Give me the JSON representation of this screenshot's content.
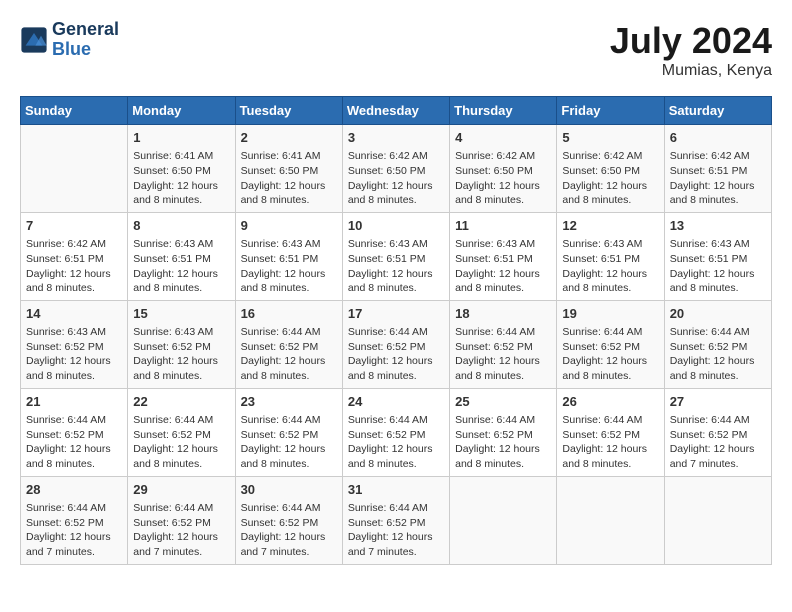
{
  "header": {
    "logo_line1": "General",
    "logo_line2": "Blue",
    "month_year": "July 2024",
    "location": "Mumias, Kenya"
  },
  "weekdays": [
    "Sunday",
    "Monday",
    "Tuesday",
    "Wednesday",
    "Thursday",
    "Friday",
    "Saturday"
  ],
  "weeks": [
    [
      {
        "day": "",
        "info": ""
      },
      {
        "day": "1",
        "info": "Sunrise: 6:41 AM\nSunset: 6:50 PM\nDaylight: 12 hours\nand 8 minutes."
      },
      {
        "day": "2",
        "info": "Sunrise: 6:41 AM\nSunset: 6:50 PM\nDaylight: 12 hours\nand 8 minutes."
      },
      {
        "day": "3",
        "info": "Sunrise: 6:42 AM\nSunset: 6:50 PM\nDaylight: 12 hours\nand 8 minutes."
      },
      {
        "day": "4",
        "info": "Sunrise: 6:42 AM\nSunset: 6:50 PM\nDaylight: 12 hours\nand 8 minutes."
      },
      {
        "day": "5",
        "info": "Sunrise: 6:42 AM\nSunset: 6:50 PM\nDaylight: 12 hours\nand 8 minutes."
      },
      {
        "day": "6",
        "info": "Sunrise: 6:42 AM\nSunset: 6:51 PM\nDaylight: 12 hours\nand 8 minutes."
      }
    ],
    [
      {
        "day": "7",
        "info": "Sunrise: 6:42 AM\nSunset: 6:51 PM\nDaylight: 12 hours\nand 8 minutes."
      },
      {
        "day": "8",
        "info": "Sunrise: 6:43 AM\nSunset: 6:51 PM\nDaylight: 12 hours\nand 8 minutes."
      },
      {
        "day": "9",
        "info": "Sunrise: 6:43 AM\nSunset: 6:51 PM\nDaylight: 12 hours\nand 8 minutes."
      },
      {
        "day": "10",
        "info": "Sunrise: 6:43 AM\nSunset: 6:51 PM\nDaylight: 12 hours\nand 8 minutes."
      },
      {
        "day": "11",
        "info": "Sunrise: 6:43 AM\nSunset: 6:51 PM\nDaylight: 12 hours\nand 8 minutes."
      },
      {
        "day": "12",
        "info": "Sunrise: 6:43 AM\nSunset: 6:51 PM\nDaylight: 12 hours\nand 8 minutes."
      },
      {
        "day": "13",
        "info": "Sunrise: 6:43 AM\nSunset: 6:51 PM\nDaylight: 12 hours\nand 8 minutes."
      }
    ],
    [
      {
        "day": "14",
        "info": "Sunrise: 6:43 AM\nSunset: 6:52 PM\nDaylight: 12 hours\nand 8 minutes."
      },
      {
        "day": "15",
        "info": "Sunrise: 6:43 AM\nSunset: 6:52 PM\nDaylight: 12 hours\nand 8 minutes."
      },
      {
        "day": "16",
        "info": "Sunrise: 6:44 AM\nSunset: 6:52 PM\nDaylight: 12 hours\nand 8 minutes."
      },
      {
        "day": "17",
        "info": "Sunrise: 6:44 AM\nSunset: 6:52 PM\nDaylight: 12 hours\nand 8 minutes."
      },
      {
        "day": "18",
        "info": "Sunrise: 6:44 AM\nSunset: 6:52 PM\nDaylight: 12 hours\nand 8 minutes."
      },
      {
        "day": "19",
        "info": "Sunrise: 6:44 AM\nSunset: 6:52 PM\nDaylight: 12 hours\nand 8 minutes."
      },
      {
        "day": "20",
        "info": "Sunrise: 6:44 AM\nSunset: 6:52 PM\nDaylight: 12 hours\nand 8 minutes."
      }
    ],
    [
      {
        "day": "21",
        "info": "Sunrise: 6:44 AM\nSunset: 6:52 PM\nDaylight: 12 hours\nand 8 minutes."
      },
      {
        "day": "22",
        "info": "Sunrise: 6:44 AM\nSunset: 6:52 PM\nDaylight: 12 hours\nand 8 minutes."
      },
      {
        "day": "23",
        "info": "Sunrise: 6:44 AM\nSunset: 6:52 PM\nDaylight: 12 hours\nand 8 minutes."
      },
      {
        "day": "24",
        "info": "Sunrise: 6:44 AM\nSunset: 6:52 PM\nDaylight: 12 hours\nand 8 minutes."
      },
      {
        "day": "25",
        "info": "Sunrise: 6:44 AM\nSunset: 6:52 PM\nDaylight: 12 hours\nand 8 minutes."
      },
      {
        "day": "26",
        "info": "Sunrise: 6:44 AM\nSunset: 6:52 PM\nDaylight: 12 hours\nand 8 minutes."
      },
      {
        "day": "27",
        "info": "Sunrise: 6:44 AM\nSunset: 6:52 PM\nDaylight: 12 hours\nand 7 minutes."
      }
    ],
    [
      {
        "day": "28",
        "info": "Sunrise: 6:44 AM\nSunset: 6:52 PM\nDaylight: 12 hours\nand 7 minutes."
      },
      {
        "day": "29",
        "info": "Sunrise: 6:44 AM\nSunset: 6:52 PM\nDaylight: 12 hours\nand 7 minutes."
      },
      {
        "day": "30",
        "info": "Sunrise: 6:44 AM\nSunset: 6:52 PM\nDaylight: 12 hours\nand 7 minutes."
      },
      {
        "day": "31",
        "info": "Sunrise: 6:44 AM\nSunset: 6:52 PM\nDaylight: 12 hours\nand 7 minutes."
      },
      {
        "day": "",
        "info": ""
      },
      {
        "day": "",
        "info": ""
      },
      {
        "day": "",
        "info": ""
      }
    ]
  ]
}
